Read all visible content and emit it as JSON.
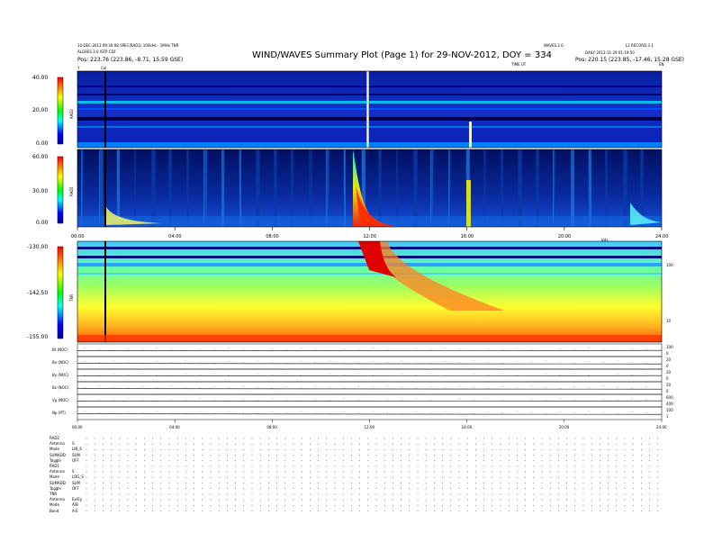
{
  "header": {
    "top_left_1": "10-DEC-2012 09:30:08 SPEC(RAD1) 100kHz - 1MHz TNR",
    "top_left_2": "ALGRES 3.0 ISTP CDF",
    "center_title": "WIND/WAVES Summary Plot (Page 1) for 29-NOV-2012, DOY = 334",
    "top_right_1": "WAVES 2.0",
    "top_right_2": "L2 RECORD 3.1",
    "top_right_3": "DAILY 2012-11-29 01:19:50",
    "left_pos": "Pos:  223.76 (223.86, -8.71, 15.59 GSE)",
    "right_pos": "Pos:  220.15 (223.85, -17.46, 15.28 GSE)",
    "time_left": "Y",
    "time_marker": "Cal",
    "time_center": "TIME UT",
    "time_right": "EN"
  },
  "panels": {
    "rad2": {
      "label": "RAD2",
      "ticks": [
        "40.00",
        "20.00",
        "0.00"
      ],
      "range": [
        0,
        45
      ]
    },
    "rad1": {
      "label": "RAD1",
      "ticks": [
        "60.00",
        "30.00",
        "0.00"
      ],
      "range": [
        0,
        70
      ]
    },
    "tnr": {
      "label": "TNR",
      "ticks": [
        "-130.00",
        "-142.50",
        "-155.00"
      ],
      "right_ticks": [
        "100",
        "10"
      ],
      "right_label": "kHz",
      "range": [
        -155,
        -130
      ]
    }
  },
  "time_axis": {
    "ticks_main": [
      "00:00",
      "04:00",
      "08:00",
      "12:00",
      "16:00",
      "20:00",
      "24:00"
    ],
    "ticks_small": [
      "00:00",
      "04:00",
      "08:00",
      "12:00",
      "16:00",
      "20:00",
      "24:00"
    ],
    "unit": "hours"
  },
  "strips": [
    {
      "label": "Bt (NOC)",
      "right": [
        "100",
        "0"
      ]
    },
    {
      "label": "Bx (NOC)",
      "right": [
        "20",
        "0"
      ]
    },
    {
      "label": "By (NOC)",
      "right": [
        "20",
        "0"
      ]
    },
    {
      "label": "Bz (NOC)",
      "right": [
        "20",
        "0"
      ]
    },
    {
      "label": "Vp (NOC)",
      "right": [
        "600",
        "400"
      ]
    },
    {
      "label": "Np (PT)",
      "right": [
        "100",
        "1"
      ]
    }
  ],
  "status_rows": [
    {
      "name": "RAD2",
      "value": ""
    },
    {
      "name": "Antenna",
      "value": "S"
    },
    {
      "name": "Mode",
      "value": "LIN_S"
    },
    {
      "name": "SUMADD",
      "value": "SUM"
    },
    {
      "name": "Toggle",
      "value": "OFF"
    },
    {
      "name": "RAD1",
      "value": ""
    },
    {
      "name": "Antenna",
      "value": "S"
    },
    {
      "name": "Mode",
      "value": "LOG_S"
    },
    {
      "name": "SUMADD",
      "value": "SUM"
    },
    {
      "name": "Toggle",
      "value": "OFF"
    },
    {
      "name": "TNR",
      "value": ""
    },
    {
      "name": "Antenna",
      "value": "Ex/Ey"
    },
    {
      "name": "Mode",
      "value": "A/B"
    },
    {
      "name": "Band",
      "value": "A-E"
    }
  ],
  "chart_data": [
    {
      "type": "heatmap",
      "title": "WIND/WAVES Summary Plot (Page 1) for 29-NOV-2012, DOY = 334",
      "ylabel": "RAD2",
      "x_range_hours": [
        0,
        24
      ],
      "ylim": [
        0,
        45
      ],
      "events_hours": [
        1.2,
        12.0,
        16.6
      ]
    },
    {
      "type": "heatmap",
      "ylabel": "RAD1",
      "x_range_hours": [
        0,
        24
      ],
      "ylim": [
        0,
        70
      ],
      "events_hours": [
        1.3,
        11.6,
        16.6,
        23.0
      ]
    },
    {
      "type": "heatmap",
      "ylabel": "TNR",
      "x_range_hours": [
        0,
        24
      ],
      "ylim": [
        -155,
        -130
      ],
      "events_hours": [
        1.2,
        12.2,
        16.8,
        23.4
      ]
    }
  ],
  "colors": {
    "cbar_top": "#ff0000",
    "cbar_mid": "#00ff00",
    "cbar_bottom": "#0000ff"
  }
}
